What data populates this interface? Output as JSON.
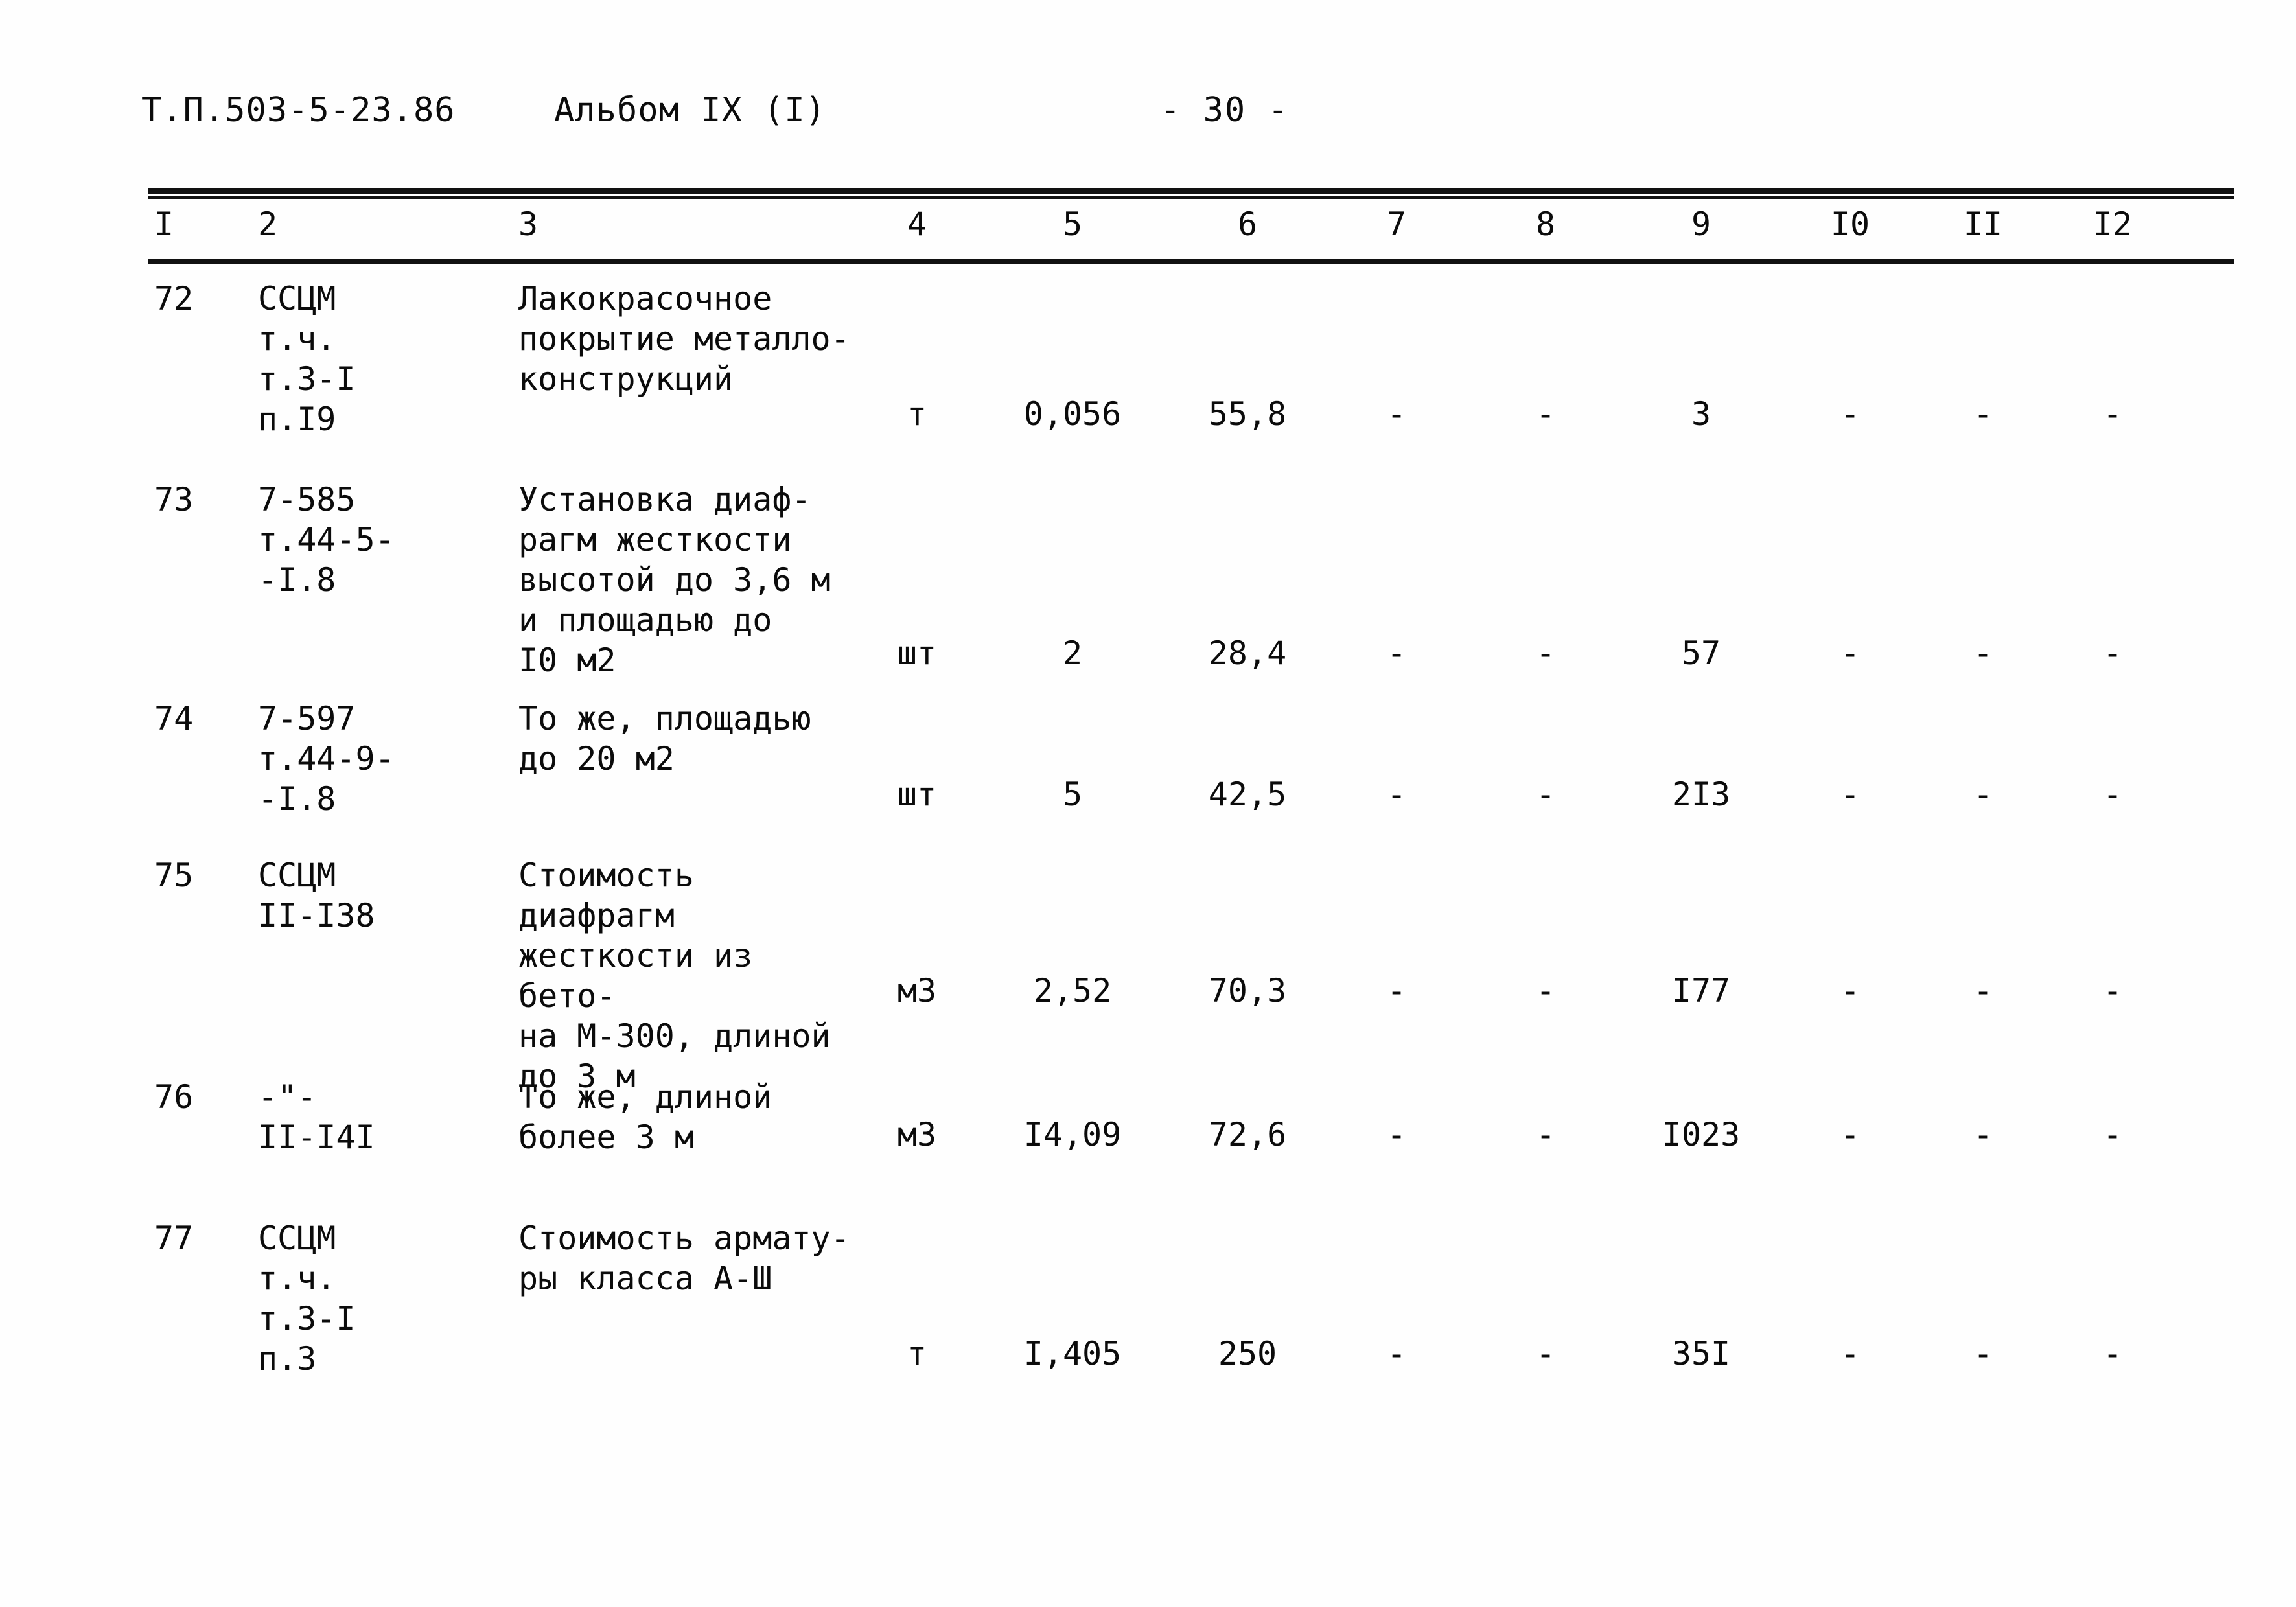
{
  "header": {
    "doc_code": "Т.П.503-5-23.86",
    "album": "Альбом IX (I)",
    "page_number": "- 30 -"
  },
  "table": {
    "column_headers": [
      "I",
      "2",
      "3",
      "4",
      "5",
      "6",
      "7",
      "8",
      "9",
      "I0",
      "II",
      "I2"
    ],
    "rows": [
      {
        "num": "72",
        "code": "ССЦМ\nт.ч.\nт.3-I\nп.I9",
        "description": "Лакокрасочное\nпокрытие металло-\nконструкций",
        "unit": "т",
        "col5": "0,056",
        "col6": "55,8",
        "col7": "-",
        "col8": "-",
        "col9": "3",
        "col10": "-",
        "col11": "-",
        "col12": "-"
      },
      {
        "num": "73",
        "code": "7-585\nт.44-5-\n-I.8",
        "description": "Установка диаф-\nрагм жесткости\nвысотой до 3,6 м\nи площадью до\nI0 м2",
        "unit": "шт",
        "col5": "2",
        "col6": "28,4",
        "col7": "-",
        "col8": "-",
        "col9": "57",
        "col10": "-",
        "col11": "-",
        "col12": "-"
      },
      {
        "num": "74",
        "code": "7-597\nт.44-9-\n-I.8",
        "description": "То же, площадью\nдо 20 м2",
        "unit": "шт",
        "col5": "5",
        "col6": "42,5",
        "col7": "-",
        "col8": "-",
        "col9": "2I3",
        "col10": "-",
        "col11": "-",
        "col12": "-"
      },
      {
        "num": "75",
        "code": "ССЦМ\nII-I38",
        "description": "Стоимость диафрагм\nжесткости из бето-\nна М-300, длиной\nдо 3 м",
        "unit": "м3",
        "col5": "2,52",
        "col6": "70,3",
        "col7": "-",
        "col8": "-",
        "col9": "I77",
        "col10": "-",
        "col11": "-",
        "col12": "-"
      },
      {
        "num": "76",
        "code": "-\"-\nII-I4I",
        "description": "То же, длиной\nболее 3 м",
        "unit": "м3",
        "col5": "I4,09",
        "col6": "72,6",
        "col7": "-",
        "col8": "-",
        "col9": "I023",
        "col10": "-",
        "col11": "-",
        "col12": "-"
      },
      {
        "num": "77",
        "code": "ССЦМ\nт.ч.\nт.3-I\nп.3",
        "description": "Стоимость армату-\nры класса А-Ш",
        "unit": "т",
        "col5": "I,405",
        "col6": "250",
        "col7": "-",
        "col8": "-",
        "col9": "35I",
        "col10": "-",
        "col11": "-",
        "col12": "-"
      }
    ]
  }
}
